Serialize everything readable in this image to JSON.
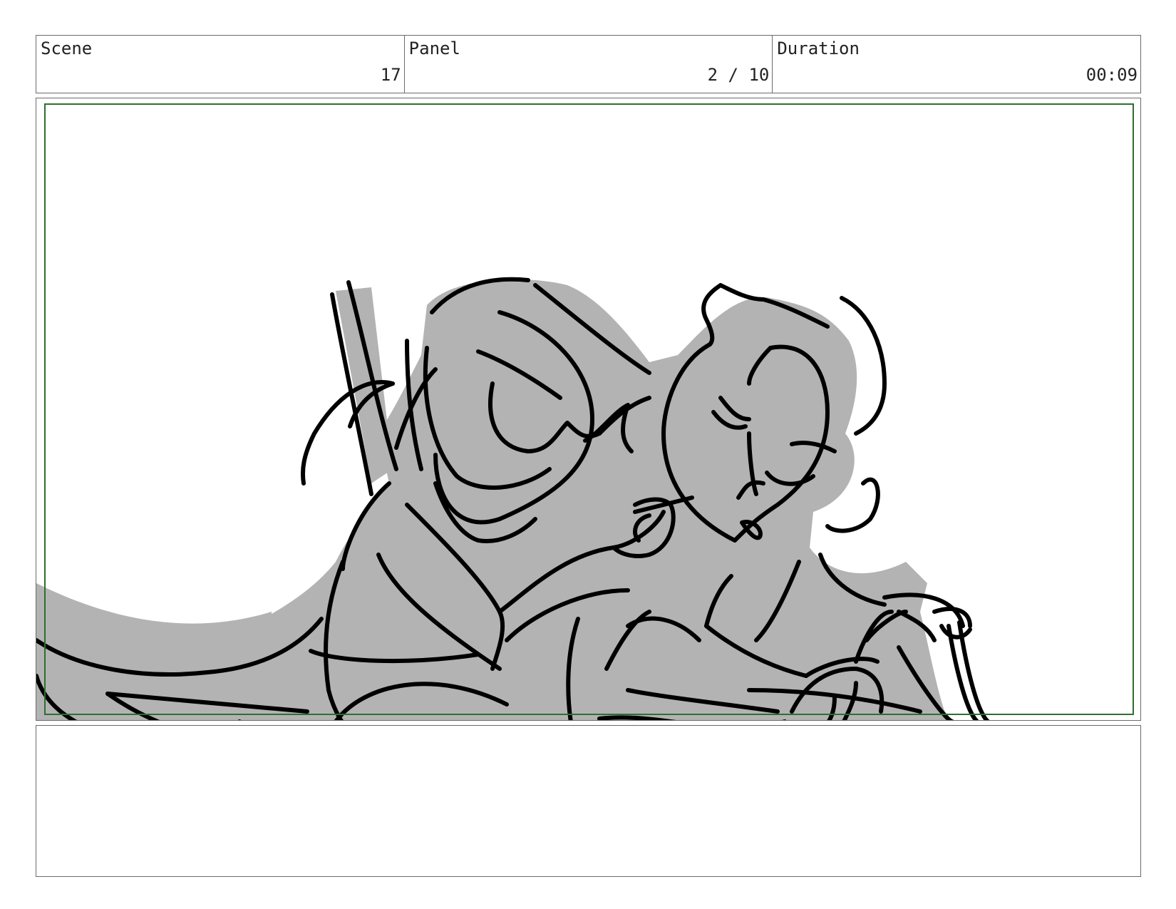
{
  "header": {
    "scene": {
      "label": "Scene",
      "value": "17"
    },
    "panel": {
      "label": "Panel",
      "value": "2 / 10"
    },
    "duration": {
      "label": "Duration",
      "value": "00:09"
    }
  },
  "frame": {
    "fill_color": "#b3b3b3",
    "line_color": "#000000",
    "safe_area_color": "#2f6f2f"
  },
  "notes": {
    "text": ""
  }
}
